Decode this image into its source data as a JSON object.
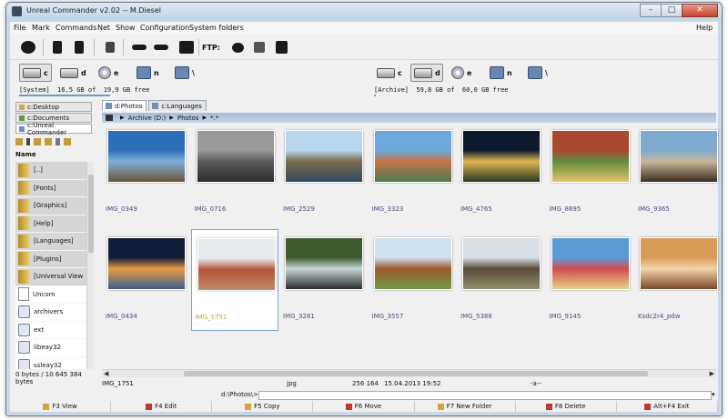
{
  "window": {
    "title": "Unreal Commander v2.02 -- M.Diesel"
  },
  "window_buttons": {
    "minimize": "–",
    "maximize": "□",
    "close": "✕"
  },
  "menu": [
    "File",
    "Mark",
    "Commands",
    "Net",
    "Show",
    "Configuration",
    "System folders"
  ],
  "menu_help": "Help",
  "toolbar": {
    "icons": [
      "swirl-icon",
      "panel-left-icon",
      "panel-right-icon",
      "filter-icon",
      "eye-left-icon",
      "eye-right-icon",
      "clipboard-icon"
    ],
    "ftp_label": "FTP:",
    "ftp_icons": [
      "ftp-connect-icon",
      "ftp-list-icon",
      "ftp-disconnect-icon"
    ]
  },
  "left_drives": {
    "items": [
      {
        "letter": "c",
        "icon": "hard-drive-icon",
        "active": true
      },
      {
        "letter": "d",
        "icon": "hard-drive-icon",
        "active": false
      },
      {
        "letter": "e",
        "icon": "cd-drive-icon",
        "active": false
      },
      {
        "letter": "n",
        "icon": "network-drive-icon",
        "active": false
      },
      {
        "letter": "\\",
        "icon": "network-icon",
        "active": false
      }
    ],
    "info": "[System]  16,5 GB of  19,9 GB free",
    "usage_fraction": 0.17
  },
  "right_drives": {
    "items": [
      {
        "letter": "c",
        "icon": "hard-drive-icon",
        "active": false
      },
      {
        "letter": "d",
        "icon": "hard-drive-icon",
        "active": true
      },
      {
        "letter": "e",
        "icon": "cd-drive-icon",
        "active": false
      },
      {
        "letter": "n",
        "icon": "network-drive-icon",
        "active": false
      },
      {
        "letter": "\\",
        "icon": "network-icon",
        "active": false
      }
    ],
    "info": "[Archive]  59,8 GB of  60,0 GB free",
    "usage_fraction": 0.003
  },
  "left_panel": {
    "tabs": [
      "c:Desktop",
      "c:Documents",
      "c:Unreal Commander"
    ],
    "column_header": "Name",
    "files": [
      {
        "name": "[..]",
        "type": "up"
      },
      {
        "name": "[Fonts]",
        "type": "folder"
      },
      {
        "name": "[Graphics]",
        "type": "folder"
      },
      {
        "name": "[Help]",
        "type": "folder"
      },
      {
        "name": "[Languages]",
        "type": "folder"
      },
      {
        "name": "[Plugins]",
        "type": "folder"
      },
      {
        "name": "[Universal View",
        "type": "folder"
      },
      {
        "name": "Uncom",
        "type": "file"
      },
      {
        "name": "archivers",
        "type": "lib"
      },
      {
        "name": "ext",
        "type": "lib"
      },
      {
        "name": "libeay32",
        "type": "lib"
      },
      {
        "name": "ssleay32",
        "type": "lib"
      }
    ],
    "status": "0 bytes / 10 645 384 bytes"
  },
  "right_panel": {
    "tabs": [
      "d:Photos",
      "c:Languages"
    ],
    "path": [
      "Archive (D:)",
      "Photos",
      "*.*"
    ],
    "thumbnails": [
      {
        "name": "IMG_0349",
        "colors": [
          "#2b6fb8",
          "#7fb0d8",
          "#6b5436"
        ]
      },
      {
        "name": "IMG_0716",
        "colors": [
          "#9a9a9a",
          "#5b5b5b",
          "#2c2c2c"
        ]
      },
      {
        "name": "IMG_2529",
        "colors": [
          "#b9d6ef",
          "#7a6a4a",
          "#2f4d63"
        ]
      },
      {
        "name": "IMG_3323",
        "colors": [
          "#6ea8dd",
          "#c6734a",
          "#4c7a4e"
        ]
      },
      {
        "name": "IMG_4765",
        "colors": [
          "#0d1a2c",
          "#e0b653",
          "#2a3a22"
        ]
      },
      {
        "name": "IMG_8695",
        "colors": [
          "#a8492f",
          "#5f8d3a",
          "#e7c26a"
        ]
      },
      {
        "name": "IMG_9365",
        "colors": [
          "#7fa9cf",
          "#c8b79a",
          "#3d2f22"
        ]
      },
      {
        "name": "IMG_0434",
        "colors": [
          "#101c38",
          "#e99a46",
          "#3c5b8f"
        ]
      },
      {
        "name": "IMG_1751",
        "colors": [
          "#e7ebee",
          "#b4543a",
          "#c08a6a"
        ],
        "selected": true
      },
      {
        "name": "IMG_3281",
        "colors": [
          "#3d5b2d",
          "#c9d7d8",
          "#2b2b2b"
        ]
      },
      {
        "name": "IMG_3557",
        "colors": [
          "#cfe0ee",
          "#9c5a2a",
          "#6c9c4a"
        ]
      },
      {
        "name": "IMG_5386",
        "colors": [
          "#d9dfe6",
          "#5a4a3a",
          "#8f8f6a"
        ]
      },
      {
        "name": "IMG_9145",
        "colors": [
          "#5a9ad6",
          "#d24d4d",
          "#e5d08a"
        ]
      },
      {
        "name": "Ksdc2r4_pdw",
        "colors": [
          "#d99a58",
          "#f2d3a8",
          "#7a4a2a"
        ]
      }
    ],
    "status": {
      "name": "IMG_1751",
      "ext": "jpg",
      "size": "256 164",
      "date": "15.04.2013 19:52",
      "attr": "-a--"
    }
  },
  "command_line": {
    "path": "d:\\Photos\\>",
    "dropdown": "▾"
  },
  "function_keys": [
    {
      "label": "F3 View",
      "icon": "view-icon"
    },
    {
      "label": "F4 Edit",
      "icon": "edit-icon"
    },
    {
      "label": "F5 Copy",
      "icon": "copy-icon"
    },
    {
      "label": "F6 Move",
      "icon": "move-icon"
    },
    {
      "label": "F7 New Folder",
      "icon": "new-folder-icon"
    },
    {
      "label": "F8 Delete",
      "icon": "delete-icon"
    },
    {
      "label": "Alt+F4 Exit",
      "icon": "exit-icon"
    }
  ]
}
